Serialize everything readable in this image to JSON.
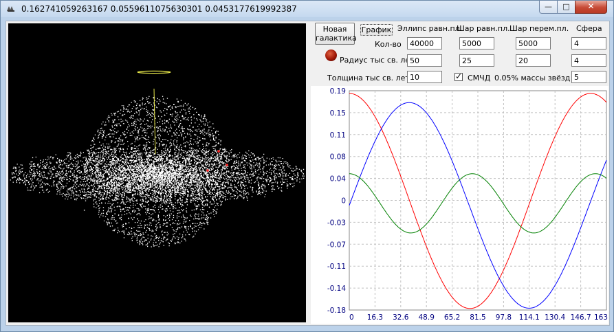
{
  "window": {
    "title": "0.162741059263167 0.0559611075630301 0.0453177619992387",
    "minimize_glyph": "—",
    "maximize_glyph": "□",
    "close_glyph": "✕",
    "icon": "galaxy-app-icon"
  },
  "controls": {
    "new_galaxy_line1": "Новая",
    "new_galaxy_line2": "галактика",
    "graph_button": "График",
    "col_headers": [
      "Эллипс равн.пл.",
      "Шар равн.пл.",
      "Шар перем.пл.",
      "Сфера"
    ],
    "row_count_label": "Кол-во",
    "row_radius_label": "Радиус тыс св. лет",
    "row_thickness_label": "Толщина тыс св. лет",
    "count_values": [
      "40000",
      "5000",
      "5000",
      "4"
    ],
    "radius_values": [
      "50",
      "25",
      "20",
      "4"
    ],
    "thickness_value": "10",
    "smchd_checked": true,
    "smchd_label": "СМЧД",
    "mass_label": "0.05% массы звёзд",
    "mass_value": "5"
  },
  "chart_data": {
    "type": "line",
    "y_ticks": [
      "0.19",
      "0.15",
      "0.11",
      "0.08",
      "0.04",
      "0",
      "-0.03",
      "-0.07",
      "-0.11",
      "-0.14",
      "-0.18"
    ],
    "x_ticks": [
      "0",
      "16.3",
      "32.6",
      "48.9",
      "65.2",
      "81.5",
      "97.8",
      "114.1",
      "130.4",
      "146.7",
      "163"
    ],
    "xlim": [
      0,
      163
    ],
    "ylim": [
      -0.18,
      0.19
    ],
    "grid": true,
    "series": [
      {
        "color": "#ff0000",
        "amplitude": 0.1815,
        "offset": 0.004,
        "phase": "cos",
        "period": 153,
        "points": [
          [
            0,
            0.19
          ],
          [
            16.3,
            0.17
          ],
          [
            32.6,
            0.107
          ],
          [
            48.9,
            0.02
          ],
          [
            65.2,
            -0.11
          ],
          [
            81.5,
            -0.18
          ],
          [
            97.8,
            -0.15
          ],
          [
            114.1,
            -0.06
          ],
          [
            130.4,
            0.05
          ],
          [
            146.7,
            0.145
          ],
          [
            163,
            0.165
          ]
        ]
      },
      {
        "color": "#0000ff",
        "amplitude": 0.1735,
        "offset": -0.0035,
        "phase": "sin",
        "period": 152,
        "points": [
          [
            0,
            0.0
          ],
          [
            16.3,
            0.12
          ],
          [
            32.6,
            0.168
          ],
          [
            48.9,
            0.14
          ],
          [
            65.2,
            0.02
          ],
          [
            81.5,
            -0.11
          ],
          [
            97.8,
            -0.17
          ],
          [
            114.1,
            -0.17
          ],
          [
            130.4,
            -0.06
          ],
          [
            146.7,
            0.03
          ],
          [
            163,
            0.05
          ]
        ]
      },
      {
        "color": "#008000",
        "amplitude": 0.05,
        "offset": 0.0,
        "phase": "cos",
        "period": 78,
        "points": [
          [
            0,
            0.05
          ],
          [
            16.3,
            0.012
          ],
          [
            32.6,
            -0.045
          ],
          [
            48.9,
            -0.03
          ],
          [
            65.2,
            0.04
          ],
          [
            81.5,
            0.046
          ],
          [
            97.8,
            -0.01
          ],
          [
            114.1,
            -0.05
          ],
          [
            130.4,
            -0.03
          ],
          [
            146.7,
            0.03
          ],
          [
            163,
            0.05
          ]
        ]
      }
    ]
  }
}
